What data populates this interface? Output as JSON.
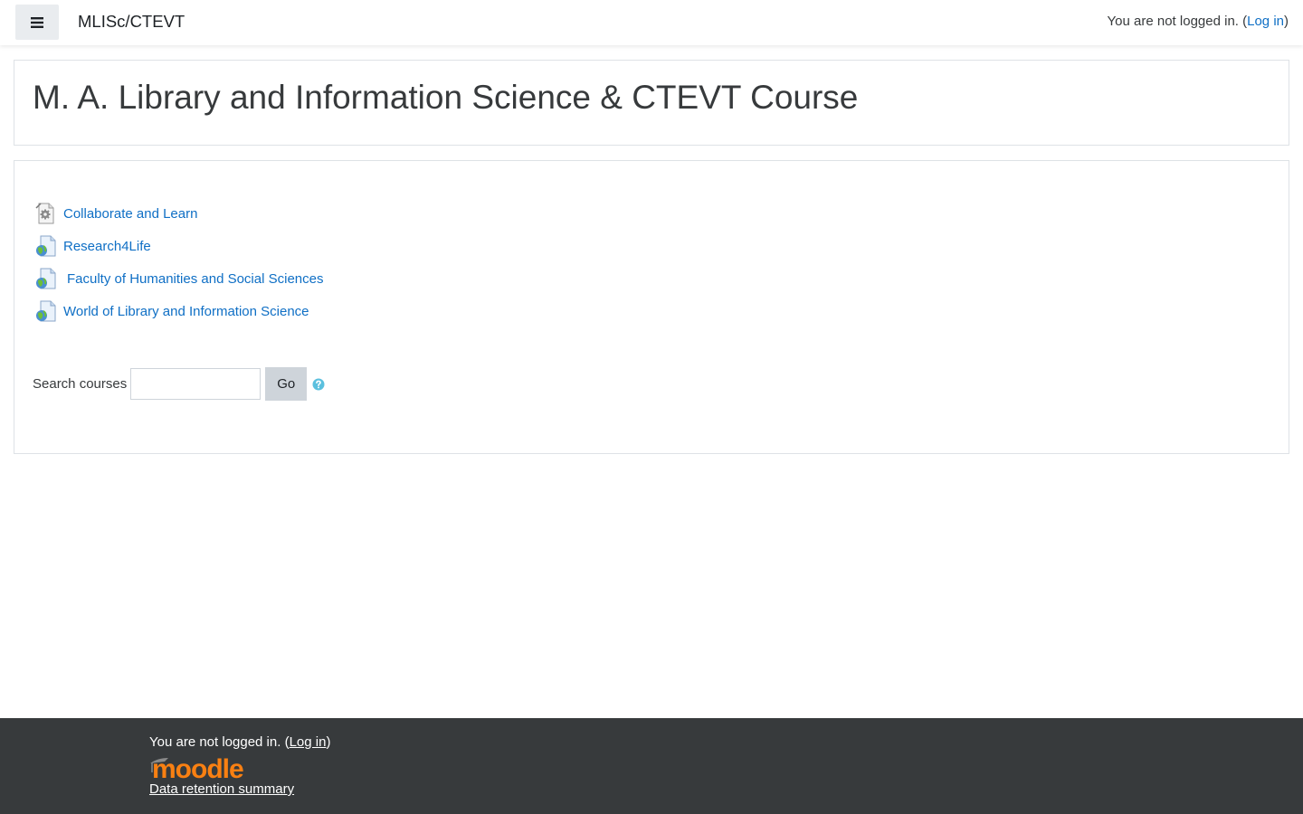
{
  "navbar": {
    "site_name": "MLISc/CTEVT",
    "login_prefix": "You are not logged in. (",
    "login_link": "Log in",
    "login_suffix": ")"
  },
  "page": {
    "title": "M. A. Library and Information Science & CTEVT Course"
  },
  "links": [
    {
      "label": "Collaborate and Learn",
      "icon": "gear-file-icon"
    },
    {
      "label": "Research4Life",
      "icon": "globe-file-icon"
    },
    {
      "label": "Faculty of Humanities and Social Sciences",
      "icon": "globe-file-icon"
    },
    {
      "label": "World of Library and Information Science",
      "icon": "globe-file-icon"
    }
  ],
  "search": {
    "label": "Search courses",
    "value": "",
    "button_label": "Go"
  },
  "footer": {
    "login_prefix": "You are not logged in. (",
    "login_link": "Log in",
    "login_suffix": ")",
    "logo_text": "moodle",
    "retention_link": "Data retention summary"
  },
  "colors": {
    "link": "#0f6fc5",
    "footer_bg": "#373a3c",
    "moodle_orange": "#f98012"
  }
}
